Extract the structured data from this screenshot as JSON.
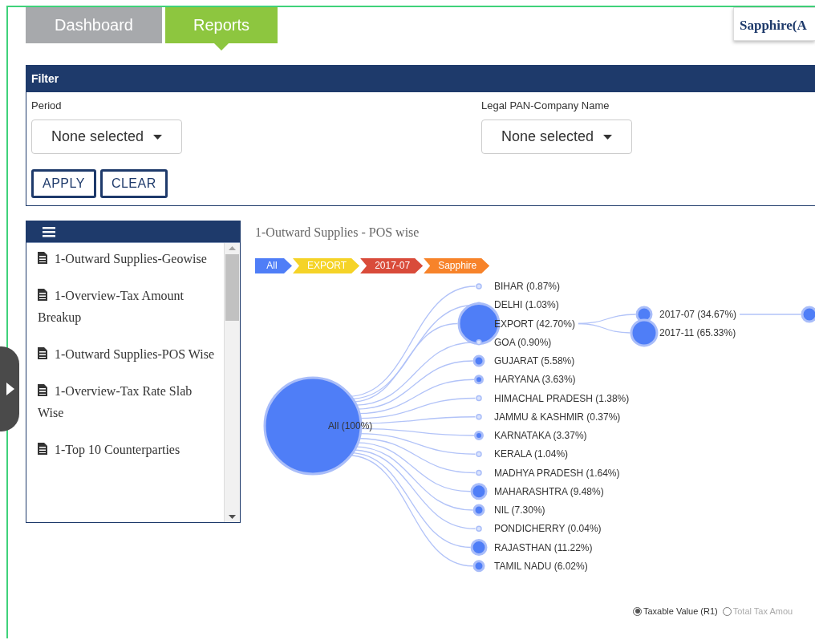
{
  "tabs": [
    {
      "label": "Dashboard",
      "selected": false
    },
    {
      "label": "Reports",
      "selected": true
    }
  ],
  "company_badge": "Sapphire(A",
  "filter": {
    "title": "Filter",
    "fields": [
      {
        "label": "Period",
        "value": "None selected"
      },
      {
        "label": "Legal PAN-Company Name",
        "value": "None selected"
      }
    ],
    "buttons": [
      "APPLY",
      "CLEAR"
    ]
  },
  "report_list": {
    "items": [
      "1-Outward Supplies-Geowise",
      "1-Overview-Tax Amount Breakup",
      "1-Outward Supplies-POS Wise",
      "1-Overview-Tax Rate Slab Wise",
      "1-Top 10 Counterparties"
    ]
  },
  "report": {
    "title": "1-Outward Supplies - POS wise",
    "breadcrumb": [
      {
        "label": "All",
        "color": "#4f7ef7"
      },
      {
        "label": "EXPORT",
        "color": "#f5d327"
      },
      {
        "label": "2017-07",
        "color": "#d94b3a"
      },
      {
        "label": "Sapphire",
        "color": "#f7832a"
      }
    ],
    "tree": {
      "label": "All (100%)",
      "kind": "root",
      "children": [
        {
          "label": "BIHAR (0.87%)",
          "kind": "tiny"
        },
        {
          "label": "DELHI (1.03%)",
          "kind": "tiny"
        },
        {
          "label": "EXPORT (42.70%)",
          "kind": "huge",
          "children": [
            {
              "label": "2017-07 (34.67%)",
              "kind": "large",
              "children": [
                {
                  "kind": "large"
                }
              ]
            },
            {
              "label": "2017-11 (65.33%)",
              "kind": "big"
            }
          ]
        },
        {
          "label": "GOA (0.90%)",
          "kind": "tiny"
        },
        {
          "label": "GUJARAT (5.58%)",
          "kind": "medium"
        },
        {
          "label": "HARYANA (3.63%)",
          "kind": "small"
        },
        {
          "label": "HIMACHAL PRADESH (1.38%)",
          "kind": "tiny"
        },
        {
          "label": "JAMMU & KASHMIR (0.37%)",
          "kind": "tiny"
        },
        {
          "label": "KARNATAKA (3.37%)",
          "kind": "small"
        },
        {
          "label": "KERALA (1.04%)",
          "kind": "tiny"
        },
        {
          "label": "MADHYA PRADESH (1.64%)",
          "kind": "tiny"
        },
        {
          "label": "MAHARASHTRA (9.48%)",
          "kind": "large"
        },
        {
          "label": "NIL (7.30%)",
          "kind": "medium"
        },
        {
          "label": "PONDICHERRY (0.04%)",
          "kind": "tiny"
        },
        {
          "label": "RAJASTHAN (11.22%)",
          "kind": "large"
        },
        {
          "label": "TAMIL NADU (6.02%)",
          "kind": "medium"
        }
      ]
    }
  },
  "measure_options": [
    {
      "label": "Taxable Value (R1)",
      "selected": true
    },
    {
      "label": "Total Tax Amou",
      "selected": false
    }
  ]
}
